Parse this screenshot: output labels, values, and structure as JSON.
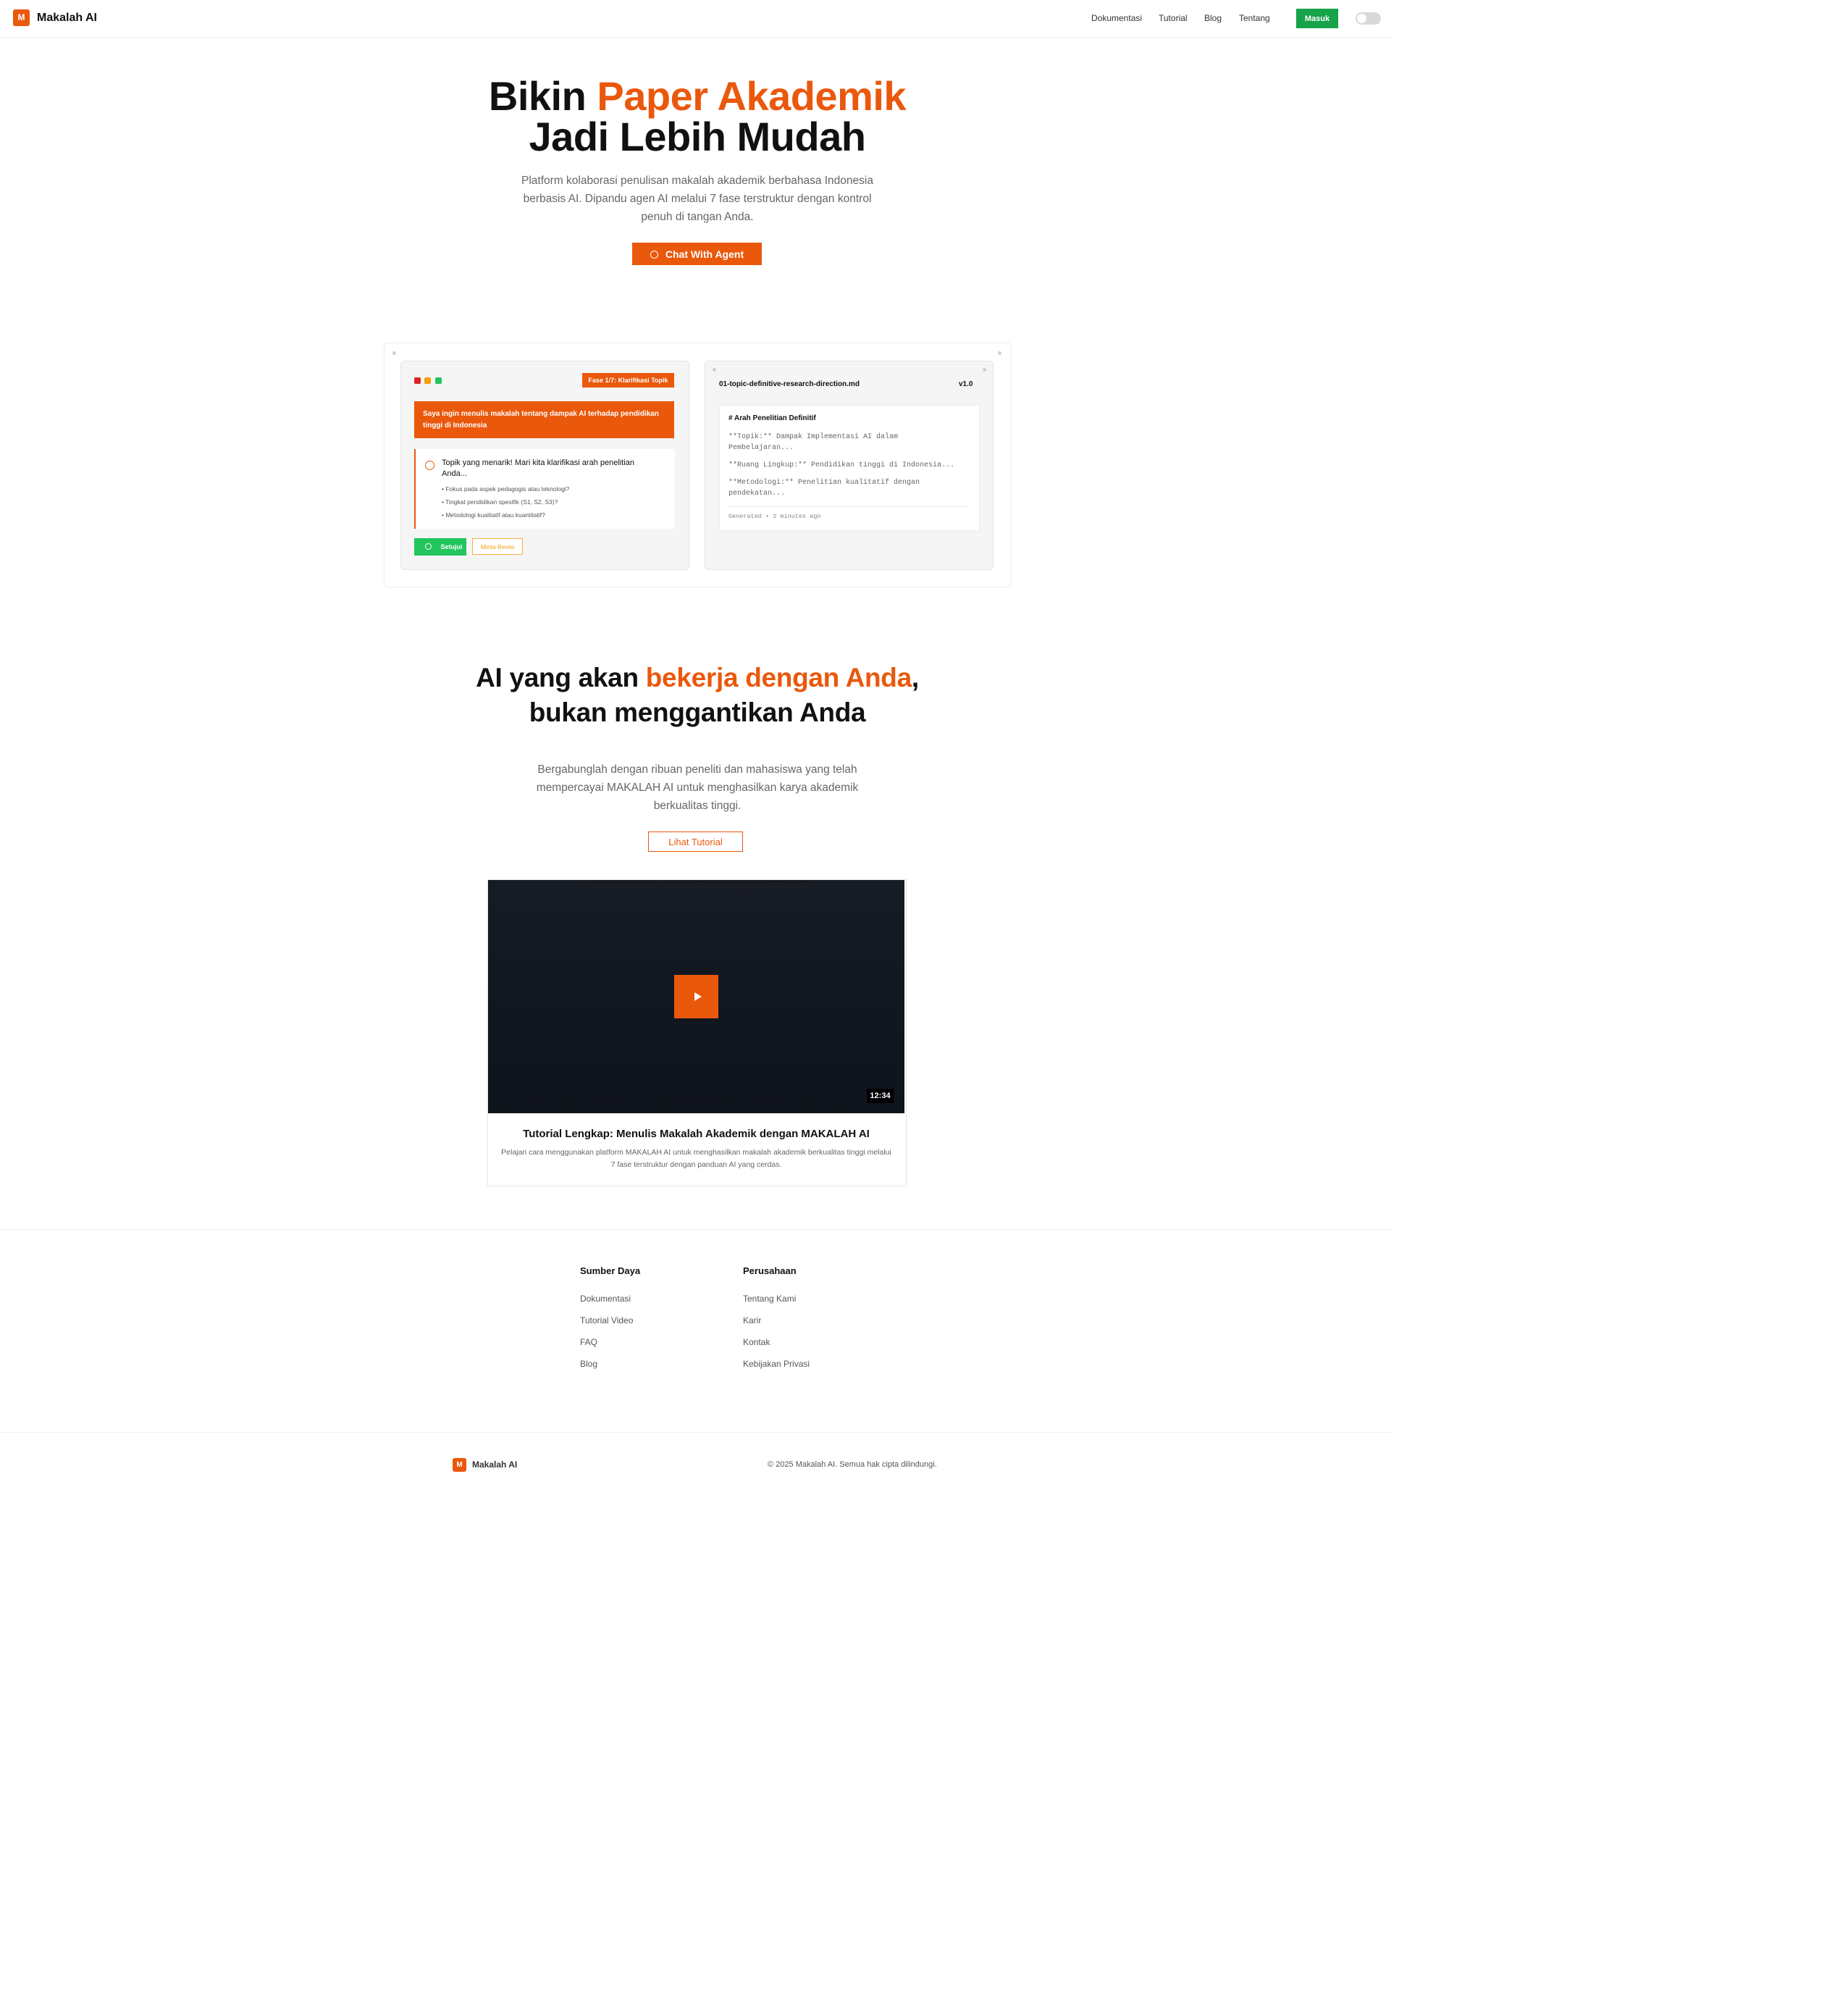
{
  "header": {
    "logo_letter": "M",
    "brand": "Makalah AI",
    "nav": [
      "Dokumentasi",
      "Tutorial",
      "Blog",
      "Tentang"
    ],
    "login_label": "Masuk",
    "theme_toggle": "off"
  },
  "hero": {
    "title_prefix": "Bikin ",
    "title_highlight": "Paper Akademik",
    "title_line2": "Jadi Lebih Mudah",
    "description": "Platform kolaborasi penulisan makalah akademik berbahasa Indonesia berbasis AI. Dipandu agen AI melalui 7 fase terstruktur dengan kontrol penuh di tangan Anda.",
    "cta_label": "Chat With Agent"
  },
  "chat_preview": {
    "phase_badge": "Fase 1/7: Klarifikasi Topik",
    "user_message": "Saya ingin menulis makalah tentang dampak AI terhadap pendidikan tinggi di Indonesia",
    "ai_message": "Topik yang menarik! Mari kita klarifikasi arah penelitian Anda...",
    "ai_bullets": [
      "• Fokus pada aspek pedagogis atau teknologi?",
      "• Tingkat pendidikan spesifik (S1, S2, S3)?",
      "• Metodologi kualitatif atau kuantitatif?"
    ],
    "approve_label": "Setujui",
    "revise_label": "Minta Revisi"
  },
  "doc_preview": {
    "filename": "01-topic-definitive-research-direction.md",
    "version": "v1.0",
    "heading": "# Arah Penelitian Definitif",
    "lines": [
      "**Topik:** Dampak Implementasi AI dalam Pembelajaran...",
      "**Ruang Lingkup:** Pendidikan tinggi di Indonesia...",
      "**Metodologi:** Penelitian kualitatif dengan pendekatan..."
    ],
    "generated": "Generated • 2 minutes ago"
  },
  "section2": {
    "title_prefix": "AI yang akan ",
    "title_highlight": "bekerja dengan Anda",
    "title_suffix": ",",
    "title_line2": "bukan menggantikan Anda",
    "description": "Bergabunglah dengan ribuan peneliti dan mahasiswa yang telah mempercayai MAKALAH AI untuk menghasilkan karya akademik berkualitas tinggi.",
    "button_label": "Lihat Tutorial"
  },
  "video": {
    "alt_text": "Tutorial Cara Menulis Makalah Akademik dengan MAKALAH AI",
    "duration": "12:34",
    "title": "Tutorial Lengkap: Menulis Makalah Akademik dengan MAKALAH AI",
    "description": "Pelajari cara menggunakan platform MAKALAH AI untuk menghasilkan makalah akademik berkualitas tinggi melalui 7 fase terstruktur dengan panduan AI yang cerdas."
  },
  "footer": {
    "columns": [
      {
        "heading": "Sumber Daya",
        "links": [
          "Dokumentasi",
          "Tutorial Video",
          "FAQ",
          "Blog"
        ]
      },
      {
        "heading": "Perusahaan",
        "links": [
          "Tentang Kami",
          "Karir",
          "Kontak",
          "Kebijakan Privasi"
        ]
      }
    ],
    "logo_letter": "M",
    "brand": "Makalah AI",
    "copyright": "© 2025 Makalah AI. Semua hak cipta dilindungi."
  },
  "colors": {
    "accent": "#ea580c",
    "success": "#16a34a",
    "text": "#111111",
    "muted": "#666666"
  },
  "icons": [
    "info-icon",
    "check-circle-icon",
    "play-icon",
    "window-dots"
  ]
}
